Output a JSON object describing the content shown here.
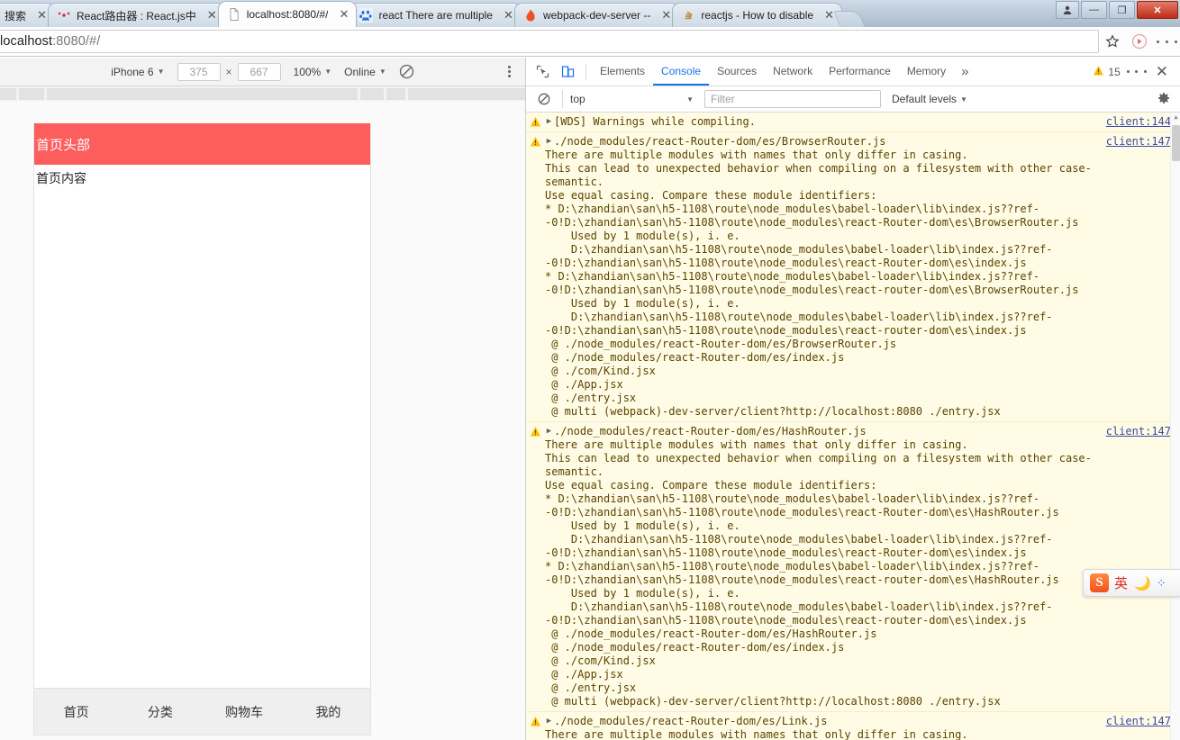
{
  "window": {
    "controls": {
      "profile": "profile-icon",
      "minimize": "—",
      "maximize": "❐",
      "close": "✕"
    }
  },
  "tabs": [
    {
      "label": "搜索",
      "favicon": "none",
      "active": false,
      "partial": true
    },
    {
      "label": "React路由器 : React.js中",
      "favicon": "react-icon",
      "active": false
    },
    {
      "label": "localhost:8080/#/",
      "favicon": "page-icon",
      "active": true
    },
    {
      "label": "react There are multiple",
      "favicon": "baidu-icon",
      "active": false
    },
    {
      "label": "webpack-dev-server --",
      "favicon": "flame-icon",
      "active": false
    },
    {
      "label": "reactjs - How to disable",
      "favicon": "stackoverflow-icon",
      "active": false
    }
  ],
  "omnibox": {
    "url_prefix": "localhost",
    "url_suffix": ":8080/#/",
    "bookmark_icon": "star-icon",
    "extension_icon": "extension-icon",
    "menu_icon": "kebab-menu-icon"
  },
  "device_toolbar": {
    "device": "iPhone 6",
    "width": "375",
    "height": "667",
    "multiply": "×",
    "zoom": "100%",
    "throttling": "Online",
    "rotate_icon": "rotate-icon",
    "menu_icon": "kebab-menu-icon"
  },
  "preview": {
    "header_text": "首页头部",
    "content_text": "首页内容",
    "header_color": "#fc5d5d",
    "tabbar": [
      {
        "label": "首页"
      },
      {
        "label": "分类"
      },
      {
        "label": "购物车"
      },
      {
        "label": "我的"
      }
    ]
  },
  "devtools": {
    "inspect_icon": "inspect-cursor-icon",
    "device_toggle_icon": "device-toolbar-icon",
    "panels": [
      {
        "label": "Elements",
        "selected": false
      },
      {
        "label": "Console",
        "selected": true
      },
      {
        "label": "Sources",
        "selected": false
      },
      {
        "label": "Network",
        "selected": false
      },
      {
        "label": "Performance",
        "selected": false
      },
      {
        "label": "Memory",
        "selected": false
      }
    ],
    "more_panels": "»",
    "warning_count": "15",
    "warning_icon": "warning-triangle-icon",
    "settings_kebab_icon": "kebab-menu-icon",
    "close_icon": "close-icon",
    "filterbar": {
      "clear_icon": "clear-console-icon",
      "context": "top",
      "filter_placeholder": "Filter",
      "levels": "Default levels",
      "gear_icon": "gear-icon"
    }
  },
  "console_messages": [
    {
      "level": "warning",
      "title": "[WDS] Warnings while compiling.",
      "source": "client:144",
      "body": ""
    },
    {
      "level": "warning",
      "title": "./node_modules/react-Router-dom/es/BrowserRouter.js",
      "source": "client:147",
      "body": "There are multiple modules with names that only differ in casing.\nThis can lead to unexpected behavior when compiling on a filesystem with other case-\nsemantic.\nUse equal casing. Compare these module identifiers:\n* D:\\zhandian\\san\\h5-1108\\route\\node_modules\\babel-loader\\lib\\index.js??ref-\n-0!D:\\zhandian\\san\\h5-1108\\route\\node_modules\\react-Router-dom\\es\\BrowserRouter.js\n    Used by 1 module(s), i. e.\n    D:\\zhandian\\san\\h5-1108\\route\\node_modules\\babel-loader\\lib\\index.js??ref-\n-0!D:\\zhandian\\san\\h5-1108\\route\\node_modules\\react-Router-dom\\es\\index.js\n* D:\\zhandian\\san\\h5-1108\\route\\node_modules\\babel-loader\\lib\\index.js??ref-\n-0!D:\\zhandian\\san\\h5-1108\\route\\node_modules\\react-router-dom\\es\\BrowserRouter.js\n    Used by 1 module(s), i. e.\n    D:\\zhandian\\san\\h5-1108\\route\\node_modules\\babel-loader\\lib\\index.js??ref-\n-0!D:\\zhandian\\san\\h5-1108\\route\\node_modules\\react-router-dom\\es\\index.js\n @ ./node_modules/react-Router-dom/es/BrowserRouter.js\n @ ./node_modules/react-Router-dom/es/index.js\n @ ./com/Kind.jsx\n @ ./App.jsx\n @ ./entry.jsx\n @ multi (webpack)-dev-server/client?http://localhost:8080 ./entry.jsx"
    },
    {
      "level": "warning",
      "title": "./node_modules/react-Router-dom/es/HashRouter.js",
      "source": "client:147",
      "body": "There are multiple modules with names that only differ in casing.\nThis can lead to unexpected behavior when compiling on a filesystem with other case-\nsemantic.\nUse equal casing. Compare these module identifiers:\n* D:\\zhandian\\san\\h5-1108\\route\\node_modules\\babel-loader\\lib\\index.js??ref-\n-0!D:\\zhandian\\san\\h5-1108\\route\\node_modules\\react-Router-dom\\es\\HashRouter.js\n    Used by 1 module(s), i. e.\n    D:\\zhandian\\san\\h5-1108\\route\\node_modules\\babel-loader\\lib\\index.js??ref-\n-0!D:\\zhandian\\san\\h5-1108\\route\\node_modules\\react-Router-dom\\es\\index.js\n* D:\\zhandian\\san\\h5-1108\\route\\node_modules\\babel-loader\\lib\\index.js??ref-\n-0!D:\\zhandian\\san\\h5-1108\\route\\node_modules\\react-router-dom\\es\\HashRouter.js\n    Used by 1 module(s), i. e.\n    D:\\zhandian\\san\\h5-1108\\route\\node_modules\\babel-loader\\lib\\index.js??ref-\n-0!D:\\zhandian\\san\\h5-1108\\route\\node_modules\\react-router-dom\\es\\index.js\n @ ./node_modules/react-Router-dom/es/HashRouter.js\n @ ./node_modules/react-Router-dom/es/index.js\n @ ./com/Kind.jsx\n @ ./App.jsx\n @ ./entry.jsx\n @ multi (webpack)-dev-server/client?http://localhost:8080 ./entry.jsx"
    },
    {
      "level": "warning",
      "title": "./node_modules/react-Router-dom/es/Link.js",
      "source": "client:147",
      "body": "There are multiple modules with names that only differ in casing."
    }
  ],
  "ime": {
    "logo": "S",
    "mode": "英",
    "moon_icon": "moon-icon",
    "dots_icon": "keyboard-icon"
  }
}
